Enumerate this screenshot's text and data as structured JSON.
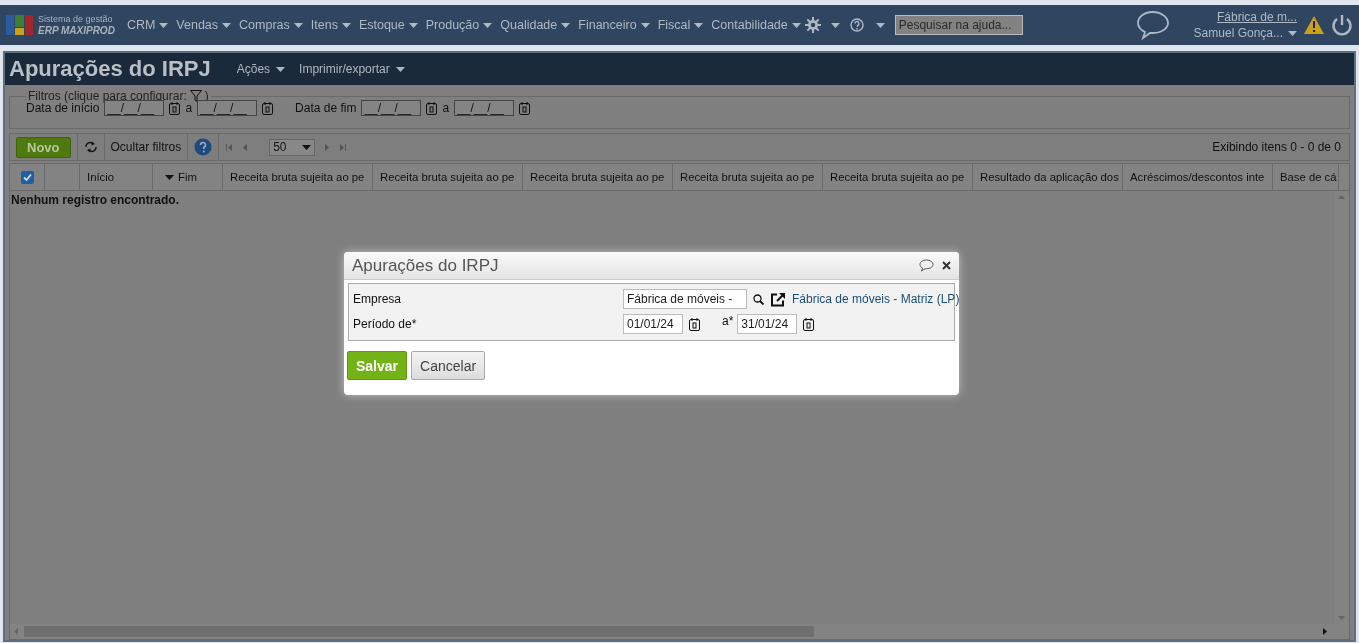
{
  "app": {
    "logo_lines": [
      "Sistema de gestão",
      "ERP MAXIPROD"
    ],
    "menu": [
      {
        "label": "CRM"
      },
      {
        "label": "Vendas"
      },
      {
        "label": "Compras"
      },
      {
        "label": "Itens"
      },
      {
        "label": "Estoque"
      },
      {
        "label": "Produção"
      },
      {
        "label": "Qualidade"
      },
      {
        "label": "Financeiro"
      },
      {
        "label": "Fiscal"
      },
      {
        "label": "Contabilidade"
      }
    ],
    "search": {
      "placeholder": "Pesquisar na ajuda..."
    },
    "company": "Fábrica de m...",
    "user": "Samuel Gonça..."
  },
  "page": {
    "title": "Apurações do IRPJ",
    "actions": [
      "Ações",
      "Imprimir/exportar"
    ]
  },
  "filters": {
    "legend": "Filtros (clique para configurar:",
    "legend_end": ")",
    "ranges": [
      {
        "label": "Data de início",
        "from": "__/__/__",
        "to_label": "a",
        "to": "__/__/__"
      },
      {
        "label": "Data de fim",
        "from": "__/__/__",
        "to_label": "a",
        "to": "__/__/__"
      }
    ]
  },
  "toolbar": {
    "new_button": "Novo",
    "hide_filters": "Ocultar filtros",
    "page_size": "50",
    "status": "Exibindo itens 0 - 0 de 0"
  },
  "table": {
    "select_all": true,
    "columns": [
      {
        "label": "Início",
        "sorted": false
      },
      {
        "label": "Fim",
        "sorted": true
      },
      {
        "label": "Receita bruta sujeita ao pe",
        "sorted": false
      },
      {
        "label": "Receita bruta sujeita ao pe",
        "sorted": false
      },
      {
        "label": "Receita bruta sujeita ao pe",
        "sorted": false
      },
      {
        "label": "Receita bruta sujeita ao pe",
        "sorted": false
      },
      {
        "label": "Receita bruta sujeita ao pe",
        "sorted": false
      },
      {
        "label": "Resultado da aplicação dos",
        "sorted": false
      },
      {
        "label": "Acréscimos/descontos inte",
        "sorted": false
      },
      {
        "label": "Base de cá",
        "sorted": false
      }
    ],
    "empty_message": "Nenhum registro encontrado."
  },
  "dialog": {
    "title": "Apurações do IRPJ",
    "company": {
      "label": "Empresa",
      "value": "Fábrica de móveis -",
      "link": "Fábrica de móveis - Matriz (LP)"
    },
    "period": {
      "label": "Período de*",
      "from": "01/01/24",
      "to_label": "a*",
      "to": "31/01/24"
    },
    "buttons": [
      {
        "label": "Salvar",
        "kind": "primary"
      },
      {
        "label": "Cancelar",
        "kind": "secondary"
      }
    ]
  }
}
